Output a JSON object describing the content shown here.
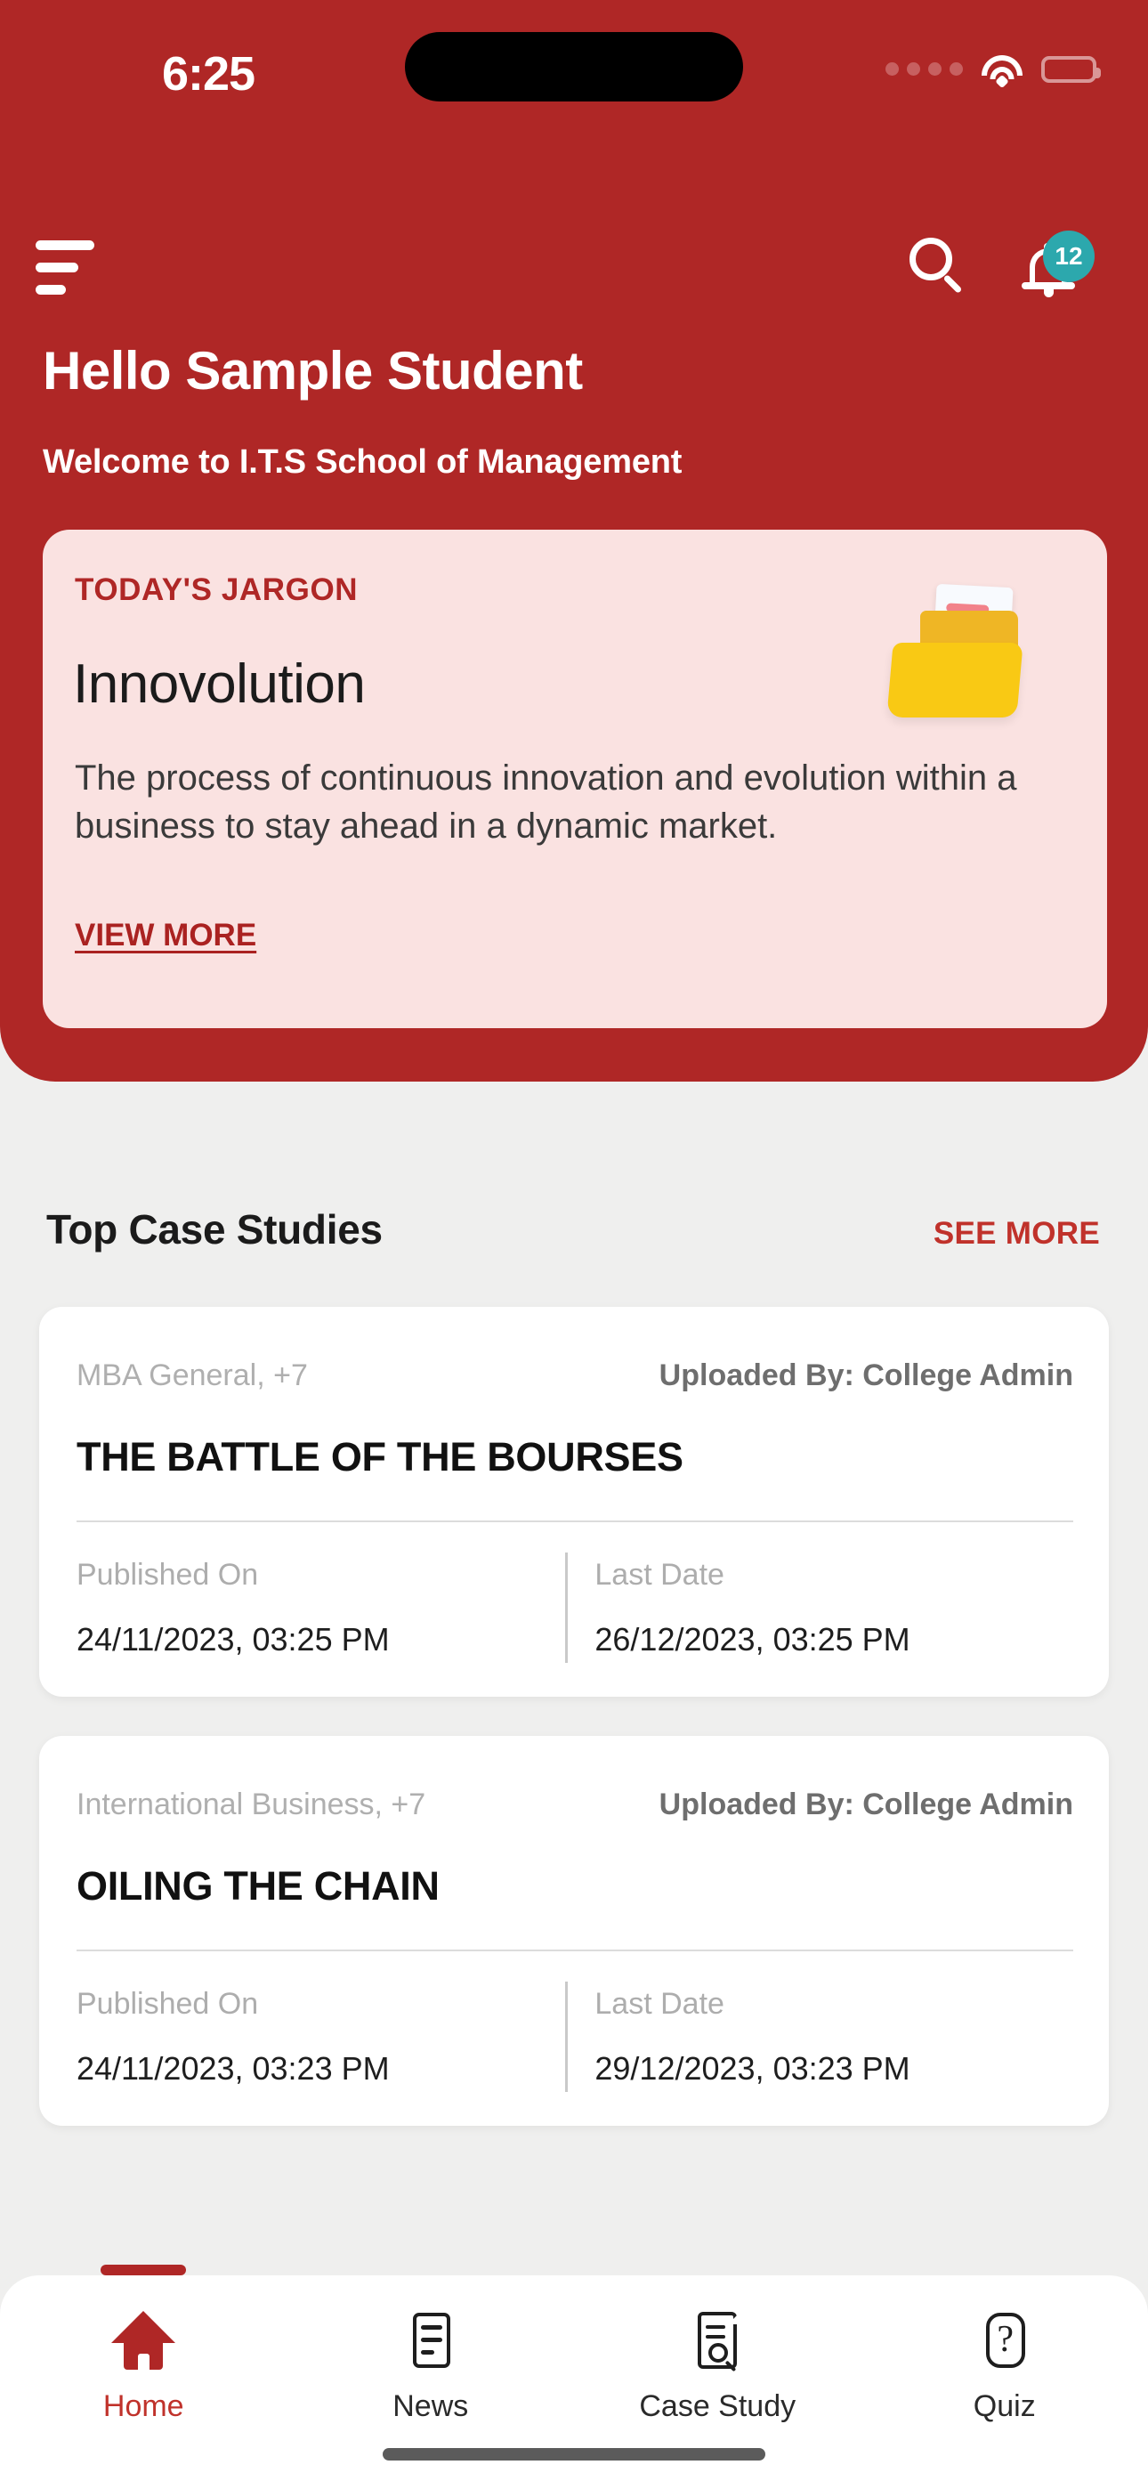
{
  "status_bar": {
    "time": "6:25",
    "signal_icon": "signal-dots-icon",
    "wifi_icon": "wifi-icon",
    "battery_icon": "battery-full-icon"
  },
  "header": {
    "menu_icon": "hamburger-menu-icon",
    "search_icon": "search-icon",
    "notification_icon": "bell-icon",
    "notification_count": "12",
    "badge_color": "#2CA8AD",
    "brand_color": "#AF2726",
    "greeting": "Hello Sample Student",
    "subtitle": "Welcome to I.T.S School of Management"
  },
  "jargon_card": {
    "label": "TODAY'S JARGON",
    "word": "Innovolution",
    "description": "The process of continuous innovation and evolution within a business to stay ahead in a dynamic market.",
    "link": "VIEW MORE",
    "illustration_icon": "folder-document-icon",
    "background_color": "#FAE2E1",
    "label_color": "#AF2726"
  },
  "case_studies_section": {
    "title": "Top Case Studies",
    "see_more": "SEE MORE",
    "see_more_color": "#C0322B",
    "published_label": "Published On",
    "last_date_label": "Last Date",
    "items": [
      {
        "tags": "MBA General, +7",
        "uploaded_by": "Uploaded By: College Admin",
        "title": "THE BATTLE OF THE BOURSES",
        "published_on": "24/11/2023, 03:25 PM",
        "last_date": "26/12/2023, 03:25 PM"
      },
      {
        "tags": "International Business, +7",
        "uploaded_by": "Uploaded By: College Admin",
        "title": "OILING THE CHAIN",
        "published_on": "24/11/2023, 03:23 PM",
        "last_date": "29/12/2023, 03:23 PM"
      }
    ]
  },
  "bottom_nav": {
    "active_index": 0,
    "active_color": "#C0322B",
    "items": [
      {
        "label": "Home",
        "icon": "home-icon"
      },
      {
        "label": "News",
        "icon": "news-list-icon"
      },
      {
        "label": "Case Study",
        "icon": "document-search-icon"
      },
      {
        "label": "Quiz",
        "icon": "question-mark-icon"
      }
    ]
  }
}
